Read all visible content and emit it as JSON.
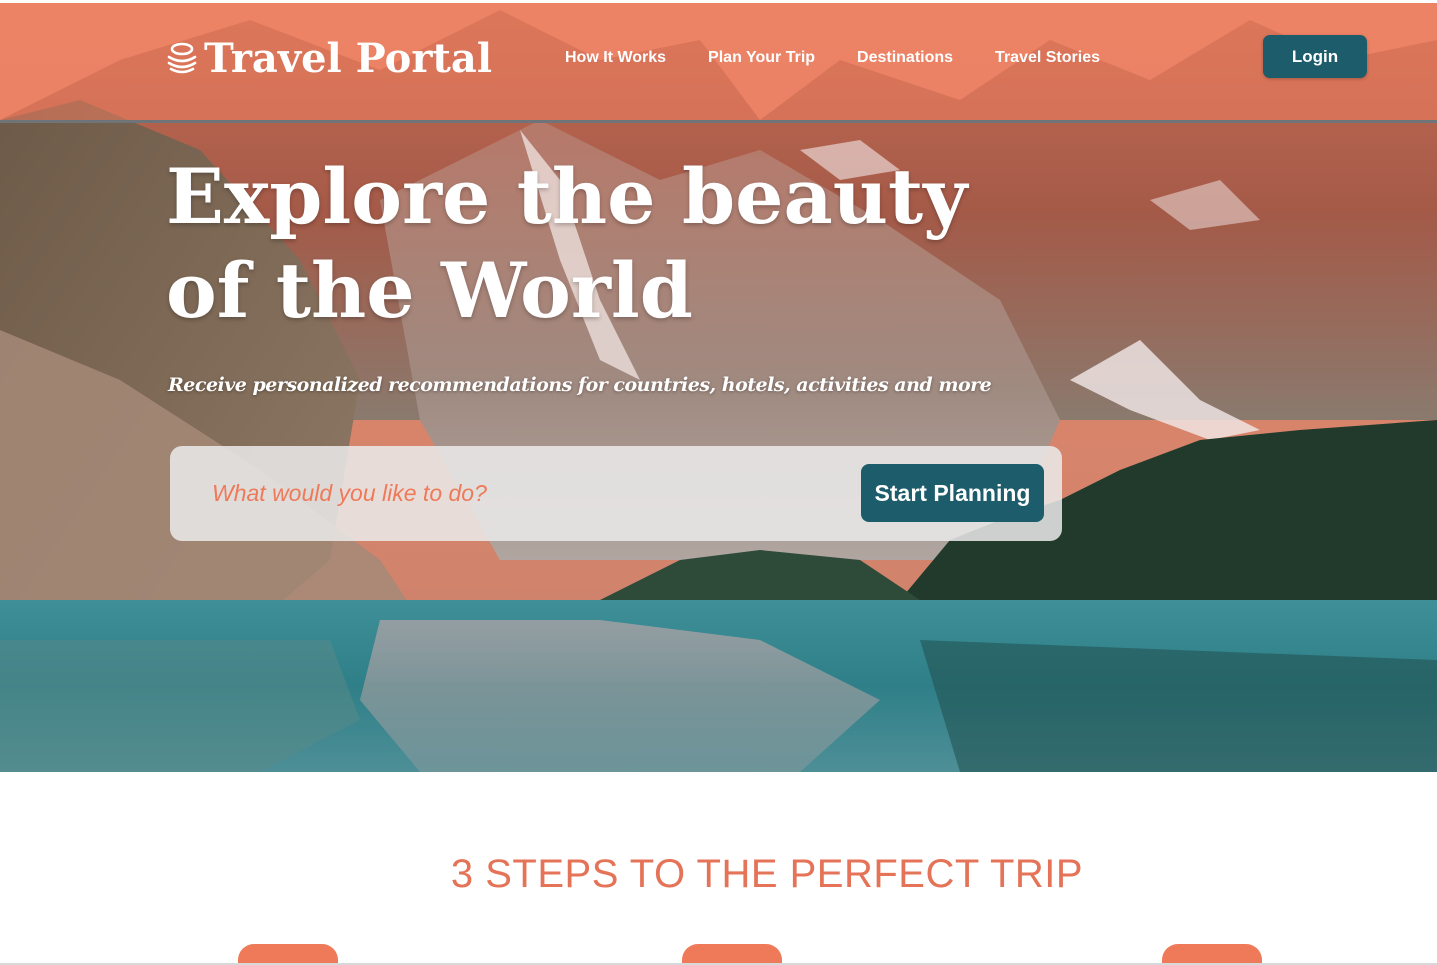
{
  "brand": {
    "name": "Travel Portal"
  },
  "nav": {
    "links": [
      "How It Works",
      "Plan Your Trip",
      "Destinations",
      "Travel Stories"
    ],
    "login_label": "Login"
  },
  "hero": {
    "title": "Explore the beauty of the World",
    "subtitle": "Receive personalized recommendations for countries, hotels, activities and more",
    "search_placeholder": "What would you like to do?",
    "cta_label": "Start Planning"
  },
  "steps": {
    "heading": "3 STEPS TO THE PERFECT TRIP"
  },
  "colors": {
    "accent": "#ee7a59",
    "primary_button": "#1d5c6b",
    "heading": "#e57358"
  }
}
